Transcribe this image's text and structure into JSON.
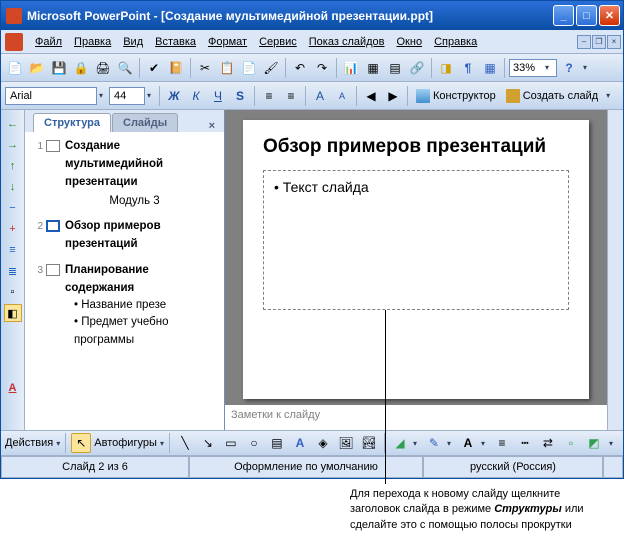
{
  "title": "Microsoft PowerPoint - [Создание мультимедийной презентации.ppt]",
  "menu": {
    "file": "Файл",
    "edit": "Правка",
    "view": "Вид",
    "insert": "Вставка",
    "format": "Формат",
    "tools": "Сервис",
    "slideshow": "Показ слайдов",
    "window": "Окно",
    "help": "Справка"
  },
  "toolbar": {
    "zoom": "33%"
  },
  "format": {
    "font": "Arial",
    "size": "44",
    "designer": "Конструктор",
    "newslide": "Создать слайд"
  },
  "tabs": {
    "outline": "Структура",
    "slides": "Слайды"
  },
  "outline": {
    "items": [
      {
        "num": "1",
        "title1": "Создание",
        "title2": "мультимедийной",
        "title3": "презентации",
        "sub": "Модуль 3"
      },
      {
        "num": "2",
        "title1": "Обзор примеров",
        "title2": "презентаций"
      },
      {
        "num": "3",
        "title1": "Планирование",
        "title2": "содержания",
        "bullets": [
          "Название презе",
          "Предмет учебно программы"
        ]
      }
    ]
  },
  "slide": {
    "title": "Обзор примеров презентаций",
    "body": "Текст слайда"
  },
  "notes": "Заметки к слайду",
  "drawing": {
    "actions": "Действия",
    "autoshapes": "Автофигуры"
  },
  "status": {
    "slide": "Слайд 2 из 6",
    "design": "Оформление по умолчанию",
    "lang": "русский (Россия)"
  },
  "callout": {
    "l1": "Для перехода к новому слайду щелкните",
    "l2": "заголовок слайда в режиме Структуры или",
    "l2b": "Структуры",
    "l3": "сделайте это с помощью полосы прокрутки"
  }
}
